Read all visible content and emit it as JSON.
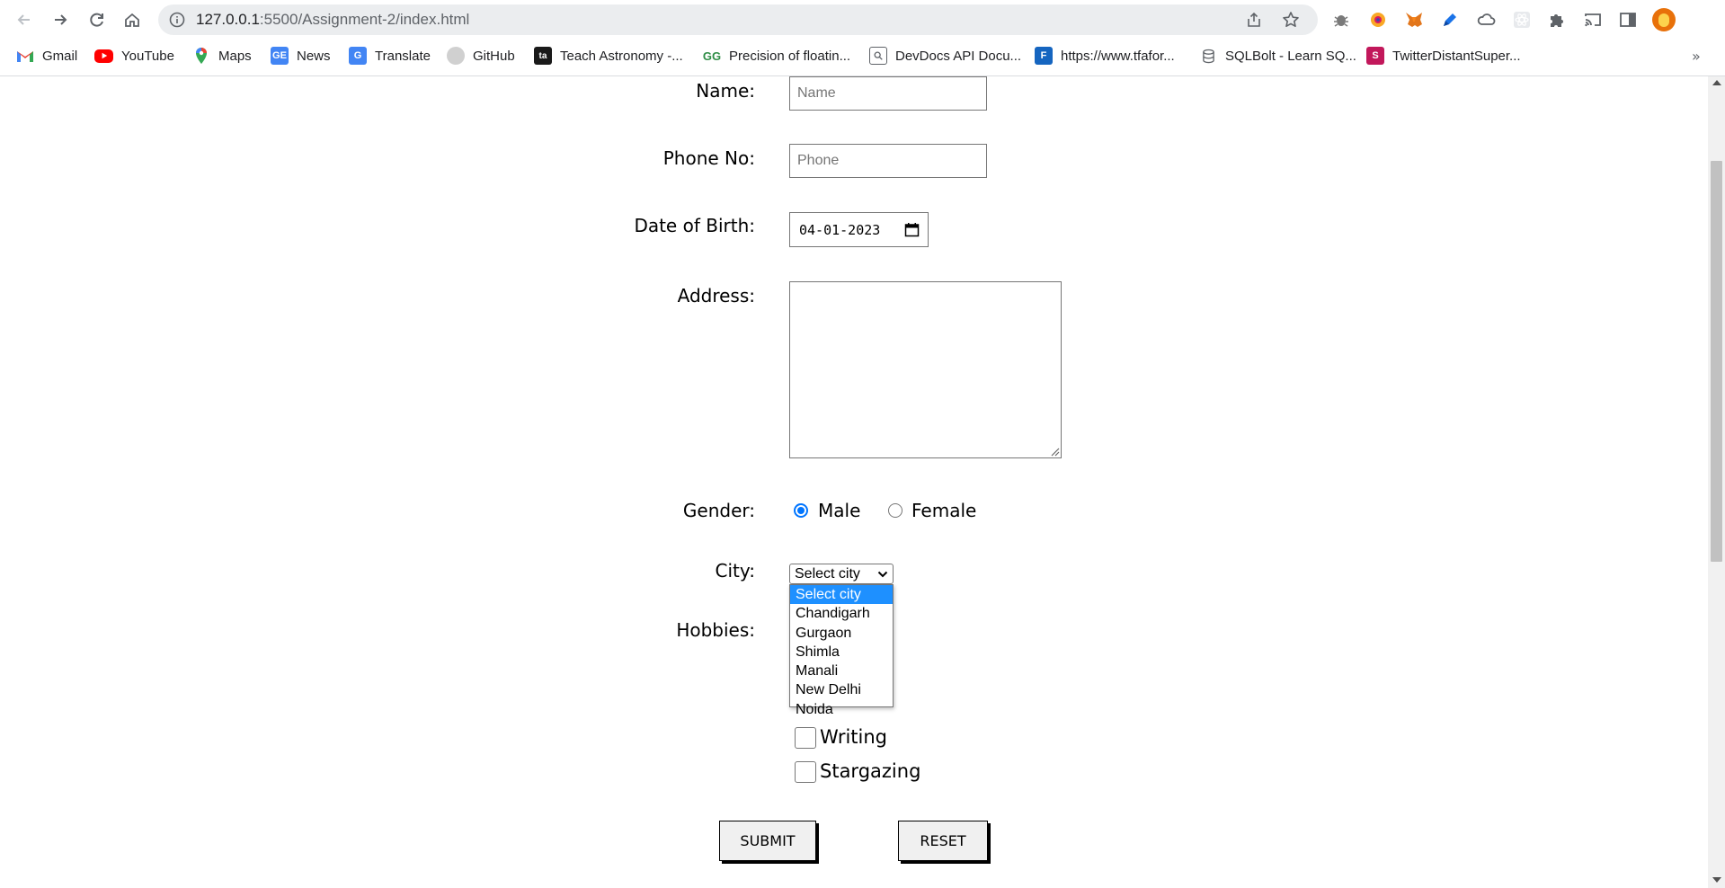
{
  "browser": {
    "url_host": "127.0.0.1",
    "url_path": ":5500/Assignment-2/index.html",
    "bookmarks": [
      {
        "label": "Gmail",
        "icon": "gmail-icon"
      },
      {
        "label": "YouTube",
        "icon": "youtube-icon"
      },
      {
        "label": "Maps",
        "icon": "maps-icon"
      },
      {
        "label": "News",
        "icon": "news-icon"
      },
      {
        "label": "Translate",
        "icon": "translate-icon"
      },
      {
        "label": "GitHub",
        "icon": "github-icon"
      },
      {
        "label": "Teach Astronomy -...",
        "icon": "astronomy-icon"
      },
      {
        "label": "Precision of floatin...",
        "icon": "geeksforgeeks-icon"
      },
      {
        "label": "DevDocs API Docu...",
        "icon": "devdocs-icon"
      },
      {
        "label": "https://www.tfafor...",
        "icon": "tfa-icon"
      },
      {
        "label": "SQLBolt - Learn SQ...",
        "icon": "database-icon"
      },
      {
        "label": "TwitterDistantSuper...",
        "icon": "s-icon"
      }
    ],
    "overflow_label": "»"
  },
  "form": {
    "name_label": "Name:",
    "name_placeholder": "Name",
    "phone_label": "Phone No:",
    "phone_placeholder": "Phone",
    "dob_label": "Date of Birth:",
    "dob_value": "04-01-2023",
    "address_label": "Address:",
    "gender_label": "Gender:",
    "gender_options": [
      "Male",
      "Female"
    ],
    "gender_selected": "Male",
    "city_label": "City:",
    "city_selected": "Select city",
    "city_options": [
      "Select city",
      "Chandigarh",
      "Gurgaon",
      "Shimla",
      "Manali",
      "New Delhi",
      "Noida"
    ],
    "hobbies_label": "Hobbies:",
    "hobbies": [
      "Writing",
      "Stargazing"
    ],
    "submit_label": "SUBMIT",
    "reset_label": "RESET"
  },
  "colors": {
    "accent": "#0075ff",
    "dropdown_highlight": "#1e90ff"
  }
}
